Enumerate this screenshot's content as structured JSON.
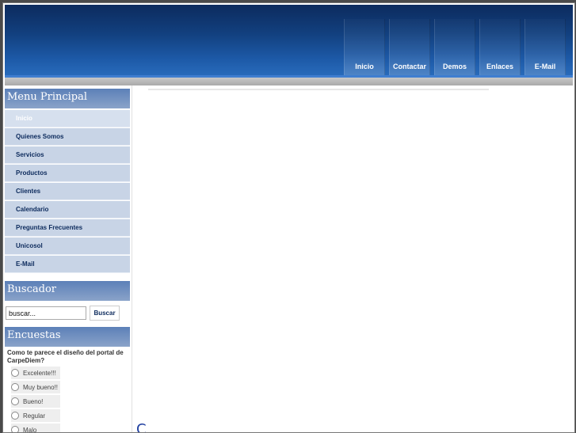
{
  "nav": {
    "items": [
      "Inicio",
      "Contactar",
      "Demos",
      "Enlaces",
      "E-Mail"
    ]
  },
  "sidebar": {
    "menu_title": "Menu Principal",
    "menu_items": [
      "Inicio",
      "Quienes Somos",
      "Servicios",
      "Productos",
      "Clientes",
      "Calendario",
      "Preguntas Frecuentes",
      "Unicosol",
      "E-Mail"
    ],
    "search_title": "Buscador",
    "search_value": "buscar...",
    "search_button": "Buscar",
    "poll_title": "Encuestas",
    "poll_question": "Como te parece el diseño del portal de CarpeDiem?",
    "poll_options": [
      "Excelente!!!",
      "Muy bueno!!",
      "Bueno!",
      "Regular",
      "Malo"
    ]
  },
  "content": {
    "partial_glyph": "C"
  },
  "colors": {
    "header_dark": "#0c2b5e",
    "header_light": "#2a6dbd",
    "module_title": "#5c80b8",
    "menu_bg": "#c8d4e6",
    "menu_text": "#0c2a5c"
  }
}
